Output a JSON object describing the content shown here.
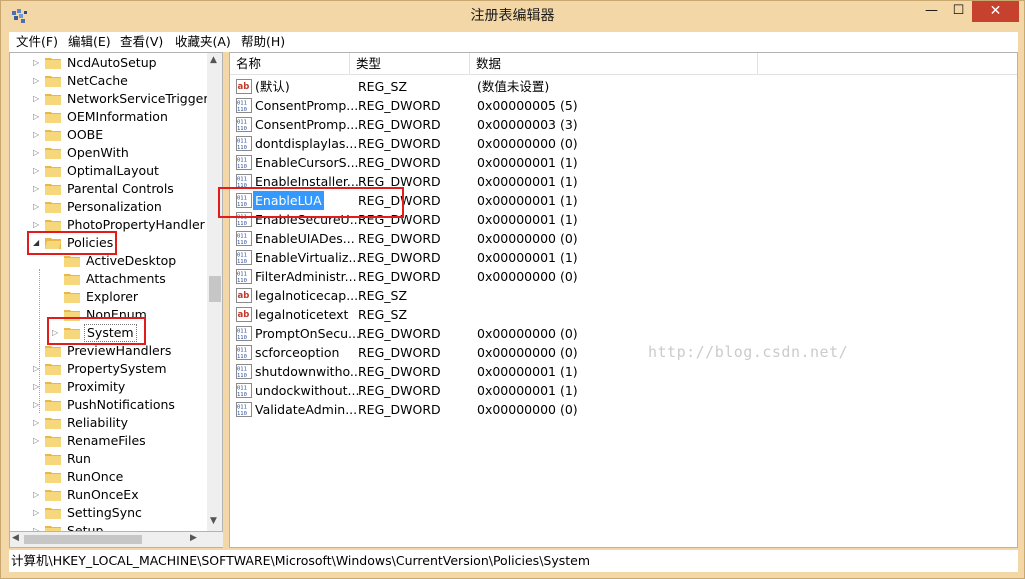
{
  "window": {
    "title": "注册表编辑器",
    "min_glyph": "—",
    "max_glyph": "☐",
    "close_glyph": "✕"
  },
  "menu": [
    "文件(F)",
    "编辑(E)",
    "查看(V)",
    "收藏夹(A)",
    "帮助(H)"
  ],
  "tree": {
    "items": [
      {
        "label": "NcdAutoSetup",
        "expander": "▷"
      },
      {
        "label": "NetCache",
        "expander": "▷"
      },
      {
        "label": "NetworkServiceTriggers",
        "expander": "▷"
      },
      {
        "label": "OEMInformation",
        "expander": "▷"
      },
      {
        "label": "OOBE",
        "expander": "▷"
      },
      {
        "label": "OpenWith",
        "expander": "▷"
      },
      {
        "label": "OptimalLayout",
        "expander": "▷"
      },
      {
        "label": "Parental Controls",
        "expander": "▷"
      },
      {
        "label": "Personalization",
        "expander": "▷"
      },
      {
        "label": "PhotoPropertyHandler",
        "expander": "▷"
      },
      {
        "label": "Policies",
        "expander": "◢"
      },
      {
        "label": "ActiveDesktop",
        "expander": ""
      },
      {
        "label": "Attachments",
        "expander": ""
      },
      {
        "label": "Explorer",
        "expander": ""
      },
      {
        "label": "NonEnum",
        "expander": ""
      },
      {
        "label": "System",
        "expander": "▷"
      },
      {
        "label": "PreviewHandlers",
        "expander": ""
      },
      {
        "label": "PropertySystem",
        "expander": "▷"
      },
      {
        "label": "Proximity",
        "expander": "▷"
      },
      {
        "label": "PushNotifications",
        "expander": "▷"
      },
      {
        "label": "Reliability",
        "expander": "▷"
      },
      {
        "label": "RenameFiles",
        "expander": "▷"
      },
      {
        "label": "Run",
        "expander": ""
      },
      {
        "label": "RunOnce",
        "expander": ""
      },
      {
        "label": "RunOnceEx",
        "expander": "▷"
      },
      {
        "label": "SettingSync",
        "expander": "▷"
      },
      {
        "label": "Setup",
        "expander": "▷"
      }
    ]
  },
  "list": {
    "columns": [
      "名称",
      "类型",
      "数据"
    ],
    "rows": [
      {
        "icon": "string",
        "name": "(默认)",
        "type": "REG_SZ",
        "data": "(数值未设置)"
      },
      {
        "icon": "dword",
        "name": "ConsentPromp...",
        "type": "REG_DWORD",
        "data": "0x00000005 (5)"
      },
      {
        "icon": "dword",
        "name": "ConsentPromp...",
        "type": "REG_DWORD",
        "data": "0x00000003 (3)"
      },
      {
        "icon": "dword",
        "name": "dontdisplaylas...",
        "type": "REG_DWORD",
        "data": "0x00000000 (0)"
      },
      {
        "icon": "dword",
        "name": "EnableCursorS...",
        "type": "REG_DWORD",
        "data": "0x00000001 (1)"
      },
      {
        "icon": "dword",
        "name": "EnableInstaller...",
        "type": "REG_DWORD",
        "data": "0x00000001 (1)"
      },
      {
        "icon": "dword",
        "name": "EnableLUA",
        "type": "REG_DWORD",
        "data": "0x00000001 (1)"
      },
      {
        "icon": "dword",
        "name": "EnableSecureU...",
        "type": "REG_DWORD",
        "data": "0x00000001 (1)"
      },
      {
        "icon": "dword",
        "name": "EnableUIADes...",
        "type": "REG_DWORD",
        "data": "0x00000000 (0)"
      },
      {
        "icon": "dword",
        "name": "EnableVirtualiz...",
        "type": "REG_DWORD",
        "data": "0x00000001 (1)"
      },
      {
        "icon": "dword",
        "name": "FilterAdministr...",
        "type": "REG_DWORD",
        "data": "0x00000000 (0)"
      },
      {
        "icon": "string",
        "name": "legalnoticecap...",
        "type": "REG_SZ",
        "data": ""
      },
      {
        "icon": "string",
        "name": "legalnoticetext",
        "type": "REG_SZ",
        "data": ""
      },
      {
        "icon": "dword",
        "name": "PromptOnSecu...",
        "type": "REG_DWORD",
        "data": "0x00000000 (0)"
      },
      {
        "icon": "dword",
        "name": "scforceoption",
        "type": "REG_DWORD",
        "data": "0x00000000 (0)"
      },
      {
        "icon": "dword",
        "name": "shutdownwitho...",
        "type": "REG_DWORD",
        "data": "0x00000001 (1)"
      },
      {
        "icon": "dword",
        "name": "undockwithout...",
        "type": "REG_DWORD",
        "data": "0x00000001 (1)"
      },
      {
        "icon": "dword",
        "name": "ValidateAdmin...",
        "type": "REG_DWORD",
        "data": "0x00000000 (0)"
      }
    ]
  },
  "status_path": "计算机\\HKEY_LOCAL_MACHINE\\SOFTWARE\\Microsoft\\Windows\\CurrentVersion\\Policies\\System",
  "watermark": "http://blog.csdn.net/",
  "colors": {
    "frame": "#f3d7a6",
    "close_button": "#c6422f",
    "selection": "#3399ff",
    "highlight_box": "#e21b1b"
  }
}
